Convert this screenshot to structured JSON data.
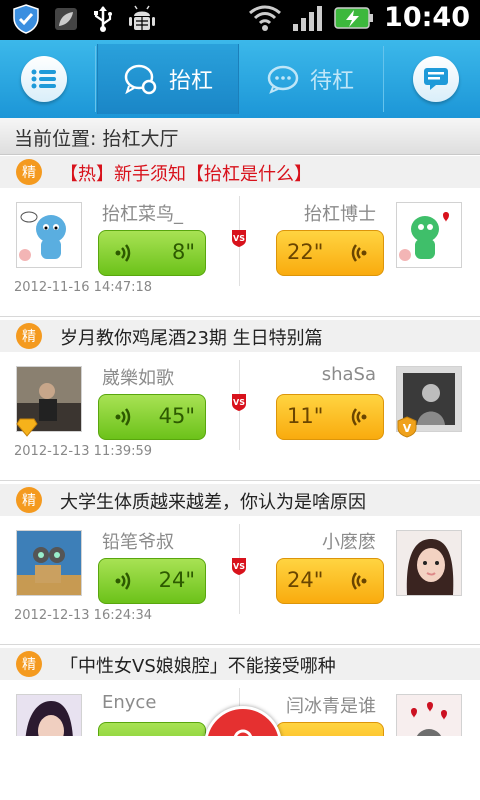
{
  "status_bar": {
    "time": "10:40"
  },
  "nav": {
    "tabs": [
      {
        "label": "抬杠",
        "active": true
      },
      {
        "label": "待杠",
        "active": false
      }
    ]
  },
  "location": "当前位置: 抬杠大厅",
  "topics": [
    {
      "badge": "精",
      "title": "【热】新手须知【抬杠是什么】",
      "hot": true
    },
    {
      "badge": "精",
      "title": "岁月教你鸡尾酒23期 生日特别篇",
      "hot": false
    },
    {
      "badge": "精",
      "title": "大学生体质越来越差，你认为是啥原因",
      "hot": false
    },
    {
      "badge": "精",
      "title": "「中性女VS娘娘腔」不能接受哪种",
      "hot": false
    }
  ],
  "debates": [
    {
      "left_user": "抬杠菜鸟_",
      "left_duration": "8\"",
      "right_user": "抬杠博士",
      "right_duration": "22\"",
      "time": "2012-11-16 14:47:18"
    },
    {
      "left_user": "崴樂如歌",
      "left_duration": "45\"",
      "right_user": "shaSa",
      "right_duration": "11\"",
      "time": "2012-12-13 11:39:59"
    },
    {
      "left_user": "铅笔爷叔",
      "left_duration": "24\"",
      "right_user": "小麽麽",
      "right_duration": "24\"",
      "time": "2012-12-13 16:24:34"
    },
    {
      "left_user": "Enyce",
      "left_duration": "",
      "right_user": "闫冰青是谁",
      "right_duration": "",
      "time": ""
    }
  ],
  "colors": {
    "nav_blue": "#1c96d7",
    "hot_red": "#d8121c",
    "green_bubble": "#6cc21a",
    "orange_bubble": "#f9ab0e",
    "badge_orange": "#f49a1f"
  }
}
